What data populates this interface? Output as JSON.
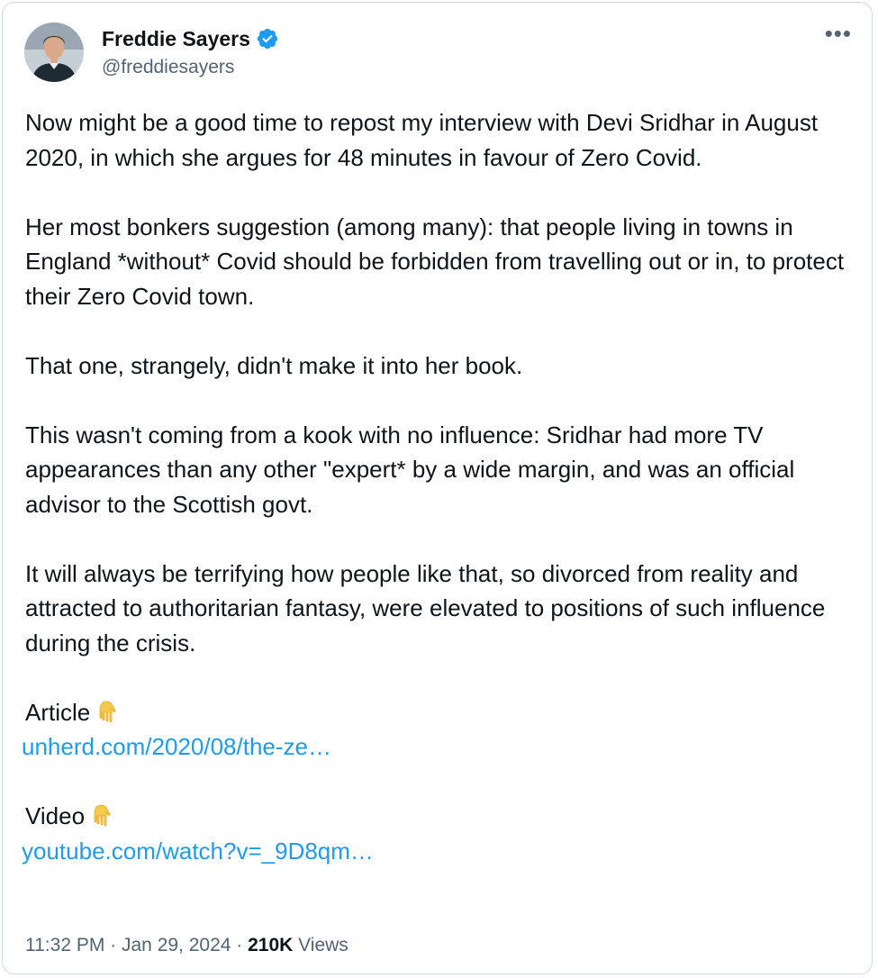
{
  "author": {
    "name": "Freddie Sayers",
    "handle": "@freddiesayers",
    "verified": true,
    "verified_color": "#1d9bf0"
  },
  "menu_icon": "more-horizontal-icon",
  "menu_glyph": "•••",
  "tweet": {
    "paragraphs": [
      "Now might be a good time to repost my interview with Devi Sridhar in August 2020, in which she argues for 48 minutes in favour of Zero Covid.",
      "Her most bonkers suggestion (among many): that people living in towns in England *without* Covid should be forbidden from travelling out or in, to protect their Zero Covid town.",
      "That one, strangely, didn't make it into her book.",
      "This wasn't coming from a kook with no influence: Sridhar had more TV appearances than any other \"expert* by a wide margin, and was an official advisor to the Scottish govt.",
      "It will always be terrifying how people like that, so divorced from reality and attracted to authoritarian fantasy, were elevated to positions of such influence during the crisis."
    ],
    "article": {
      "label": "Article",
      "emoji": "pointing-down-hand-icon",
      "link": "unherd.com/2020/08/the-ze…"
    },
    "video": {
      "label": "Video",
      "emoji": "pointing-down-hand-icon",
      "link": "youtube.com/watch?v=_9D8qm…"
    }
  },
  "meta": {
    "time": "11:32 PM",
    "separator": " · ",
    "date": "Jan 29, 2024",
    "views_count": "210K",
    "views_label": " Views"
  },
  "colors": {
    "text": "#0f1419",
    "secondary": "#536471",
    "link": "#1d9bf0",
    "border": "#cfd9de"
  }
}
